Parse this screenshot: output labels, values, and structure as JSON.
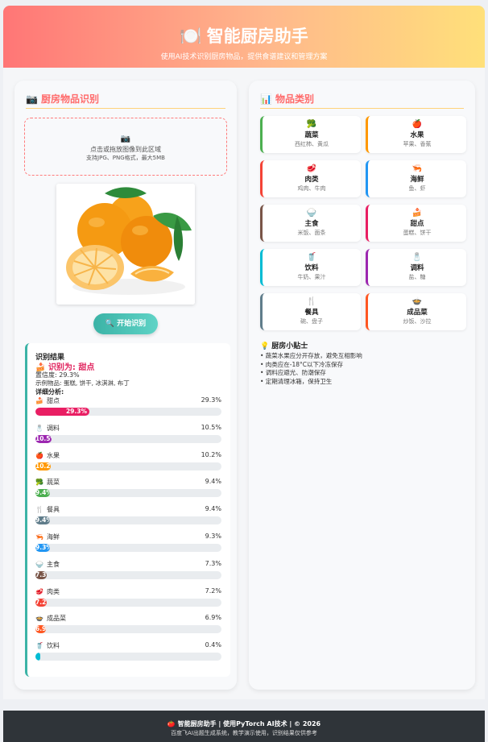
{
  "header": {
    "icon": "plate-fork-icon",
    "icon_glyph": "🍽️",
    "title": "智能厨房助手",
    "subtitle": "使用AI技术识别厨房物品，提供食谱建议和管理方案"
  },
  "recognition": {
    "title_icon": "📷",
    "title": "厨房物品识别",
    "upload": {
      "icon": "📷",
      "line1": "点击或拖放图像到此区域",
      "line2": "支持JPG、PNG格式，最大5MB"
    },
    "start_button": "🔍 开始识别",
    "result": {
      "title": "识别结果",
      "category_icon": "🍰",
      "category": "识别为: 甜点",
      "confidence": "置信度: 29.3%",
      "examples": "示例物品: 蛋糕, 饼干, 冰淇淋, 布丁",
      "details_label": "详细分析:",
      "probabilities": [
        {
          "icon": "🍰",
          "name": "甜点",
          "value": 29.3,
          "label": "29.3%",
          "bar_text": "29.3%",
          "color": "#e91e63"
        },
        {
          "icon": "🧂",
          "name": "调料",
          "value": 10.5,
          "label": "10.5%",
          "bar_text": "10.5%",
          "color": "#9c27b0"
        },
        {
          "icon": "🍎",
          "name": "水果",
          "value": 10.2,
          "label": "10.2%",
          "bar_text": "10.2%",
          "color": "#ff9800"
        },
        {
          "icon": "🥦",
          "name": "蔬菜",
          "value": 9.4,
          "label": "9.4%",
          "bar_text": "9.4%",
          "color": "#4caf50"
        },
        {
          "icon": "🍴",
          "name": "餐具",
          "value": 9.4,
          "label": "9.4%",
          "bar_text": "9.4%",
          "color": "#607d8b"
        },
        {
          "icon": "🦐",
          "name": "海鲜",
          "value": 9.3,
          "label": "9.3%",
          "bar_text": "9.3%",
          "color": "#2196f3"
        },
        {
          "icon": "🍚",
          "name": "主食",
          "value": 7.3,
          "label": "7.3%",
          "bar_text": "7.3%",
          "color": "#795548"
        },
        {
          "icon": "🥩",
          "name": "肉类",
          "value": 7.2,
          "label": "7.2%",
          "bar_text": "7.2%",
          "color": "#f44336"
        },
        {
          "icon": "🍲",
          "name": "成品菜",
          "value": 6.9,
          "label": "6.9%",
          "bar_text": "6.9%",
          "color": "#ff5722"
        },
        {
          "icon": "🥤",
          "name": "饮料",
          "value": 0.4,
          "label": "0.4%",
          "bar_text": "",
          "color": "#00bcd4"
        }
      ]
    }
  },
  "categories": {
    "title_icon": "📊",
    "title": "物品类别",
    "items": [
      {
        "icon": "🥦",
        "name": "蔬菜",
        "examples": "西红柿、黄瓜",
        "color": "#4caf50"
      },
      {
        "icon": "🍎",
        "name": "水果",
        "examples": "苹果、香蕉",
        "color": "#ff9800"
      },
      {
        "icon": "🥩",
        "name": "肉类",
        "examples": "鸡肉、牛肉",
        "color": "#f44336"
      },
      {
        "icon": "🦐",
        "name": "海鲜",
        "examples": "鱼、虾",
        "color": "#2196f3"
      },
      {
        "icon": "🍚",
        "name": "主食",
        "examples": "米饭、面条",
        "color": "#795548"
      },
      {
        "icon": "🍰",
        "name": "甜点",
        "examples": "蛋糕、饼干",
        "color": "#e91e63"
      },
      {
        "icon": "🥤",
        "name": "饮料",
        "examples": "牛奶、果汁",
        "color": "#00bcd4"
      },
      {
        "icon": "🧂",
        "name": "调料",
        "examples": "盐、糖",
        "color": "#9c27b0"
      },
      {
        "icon": "🍴",
        "name": "餐具",
        "examples": "碗、盘子",
        "color": "#607d8b"
      },
      {
        "icon": "🍲",
        "name": "成品菜",
        "examples": "炒饭、沙拉",
        "color": "#ff5722"
      }
    ],
    "tips": {
      "icon": "💡",
      "title": "厨房小贴士",
      "items": [
        "• 蔬菜水果应分开存放，避免互相影响",
        "• 肉类应在-18°C以下冷冻保存",
        "• 调料应避光、防潮保存",
        "• 定期清理冰箱，保持卫生"
      ]
    }
  },
  "footer": {
    "line1": "🍅 智能厨房助手 | 使用PyTorch AI技术 | © 2026",
    "line2": "百度飞AI出题生成系统，教学演示使用，识别结果仅供参考"
  }
}
